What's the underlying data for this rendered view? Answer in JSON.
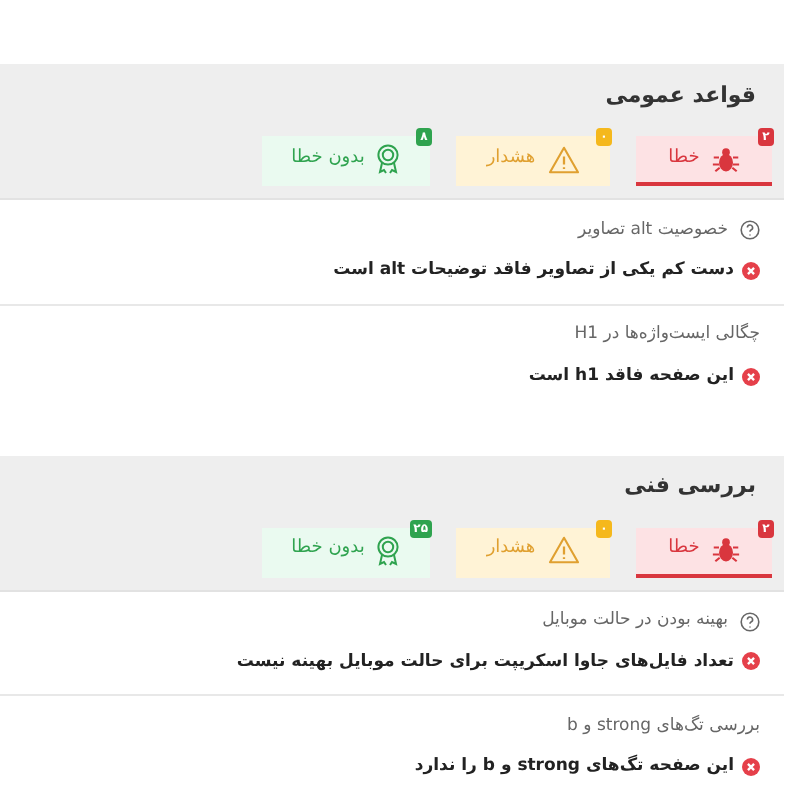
{
  "sections": [
    {
      "title": "قواعد عمومی",
      "tabs": [
        {
          "kind": "error",
          "label": "خطا",
          "count": "۲",
          "selected": true
        },
        {
          "kind": "warning",
          "label": "هشدار",
          "count": "۰",
          "selected": false
        },
        {
          "kind": "success",
          "label": "بدون خطا",
          "count": "۸",
          "selected": false
        }
      ],
      "checks": [
        {
          "title": "خصوصیت alt تصاویر",
          "help": true,
          "message": "دست کم یکی از تصاویر فاقد توضیحات alt است"
        },
        {
          "title": "چگالی ایست‌واژه‌ها در H1",
          "help": false,
          "message": "این صفحه فاقد h1 است"
        }
      ]
    },
    {
      "title": "بررسی فنی",
      "tabs": [
        {
          "kind": "error",
          "label": "خطا",
          "count": "۲",
          "selected": true
        },
        {
          "kind": "warning",
          "label": "هشدار",
          "count": "۰",
          "selected": false
        },
        {
          "kind": "success",
          "label": "بدون خطا",
          "count": "۲۵",
          "selected": false
        }
      ],
      "checks": [
        {
          "title": "بهینه بودن در حالت موبایل",
          "help": true,
          "message": "تعداد فایل‌های جاوا اسکریپت برای حالت موبایل بهینه نیست"
        },
        {
          "title": "بررسی تگ‌های strong و b",
          "help": false,
          "message": "این صفحه تگ‌های strong و b را ندارد"
        }
      ]
    }
  ]
}
